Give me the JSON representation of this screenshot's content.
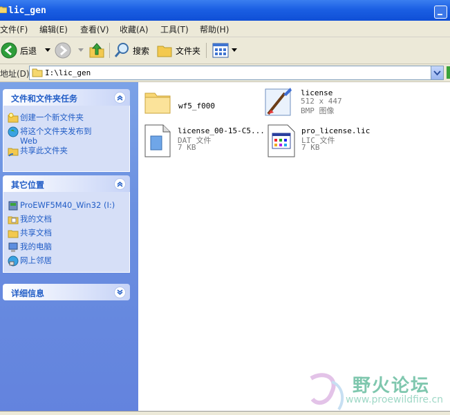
{
  "window": {
    "title": "lic_gen"
  },
  "menu": [
    "文件(F)",
    "编辑(E)",
    "查看(V)",
    "收藏(A)",
    "工具(T)",
    "帮助(H)"
  ],
  "toolbar": {
    "back_label": "后退",
    "search_label": "搜索",
    "folders_label": "文件夹"
  },
  "address": {
    "label": "地址(D)",
    "path": "I:\\lic_gen"
  },
  "tasks_panel": {
    "title": "文件和文件夹任务",
    "items": [
      "创建一个新文件夹",
      "将这个文件夹发布到",
      "Web",
      "共享此文件夹"
    ]
  },
  "places_panel": {
    "title": "其它位置",
    "items": [
      "ProEWF5M40_Win32 (I:)",
      "我的文档",
      "共享文档",
      "我的电脑",
      "网上邻居"
    ]
  },
  "details_panel": {
    "title": "详细信息"
  },
  "files": [
    {
      "name": "wf5_f000",
      "meta1": "",
      "meta2": "",
      "icon": "folder-icon"
    },
    {
      "name": "license",
      "meta1": "512 x 447",
      "meta2": "BMP 图像",
      "icon": "bitmap-icon"
    },
    {
      "name": "license_00-15-C5...",
      "meta1": "DAT 文件",
      "meta2": "7 KB",
      "icon": "dat-file-icon"
    },
    {
      "name": "pro_license.lic",
      "meta1": "LIC 文件",
      "meta2": "7 KB",
      "icon": "lic-file-icon"
    }
  ],
  "watermark": {
    "text": "野火论坛",
    "url": "www.proewildfire.cn"
  }
}
